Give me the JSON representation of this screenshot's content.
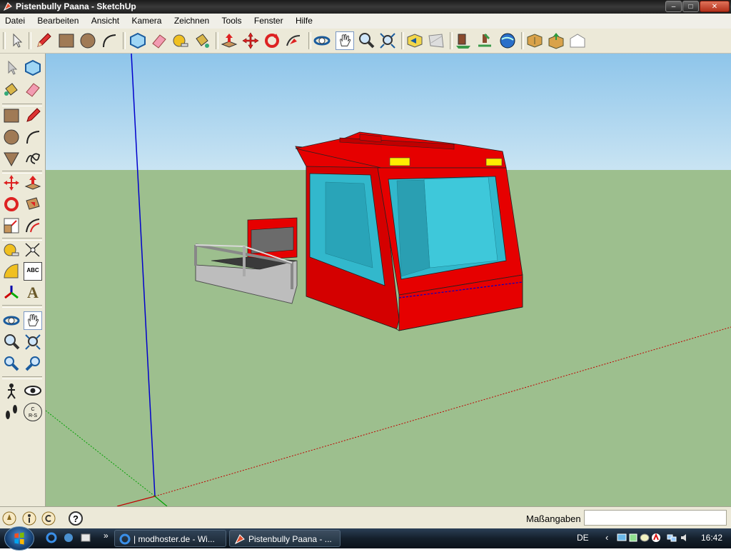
{
  "window": {
    "title": "Pistenbully Paana - SketchUp",
    "controls": {
      "minimize": "–",
      "maximize": "□",
      "close": "✕"
    }
  },
  "menu": [
    "Datei",
    "Bearbeiten",
    "Ansicht",
    "Kamera",
    "Zeichnen",
    "Tools",
    "Fenster",
    "Hilfe"
  ],
  "toolbar_icons": [
    "select-icon",
    "pencil-icon",
    "rectangle-icon",
    "circle-icon",
    "arc-icon",
    "make-component-icon",
    "eraser-icon",
    "tape-measure-icon",
    "paint-bucket-icon",
    "push-pull-icon",
    "move-icon",
    "rotate-icon",
    "follow-me-icon",
    "orbit-icon",
    "pan-icon",
    "zoom-icon",
    "zoom-extents-icon",
    "previous-view-icon",
    "next-view-icon",
    "get-models-icon",
    "share-model-icon",
    "google-earth-icon",
    "make-component-2-icon",
    "share-component-icon",
    "get-current-view-icon"
  ],
  "left_tools": [
    "select-icon",
    "make-component-icon",
    "paint-bucket-icon",
    "eraser-icon",
    "rectangle-icon",
    "pencil-icon",
    "circle-icon",
    "arc-icon",
    "polygon-icon",
    "freehand-icon",
    "move-icon",
    "push-pull-icon",
    "rotate-icon",
    "follow-me-icon",
    "scale-icon",
    "offset-icon",
    "tape-measure-icon",
    "dimension-icon",
    "protractor-icon",
    "text-icon",
    "axes-icon",
    "3d-text-icon",
    "orbit-icon",
    "pan-icon",
    "zoom-icon",
    "zoom-window-icon",
    "previous-icon",
    "zoom-extents-icon",
    "position-camera-icon",
    "look-around-icon",
    "walk-icon",
    "section-plane-icon"
  ],
  "left_tool_labels": {
    "dimension": "ABC",
    "text": "A",
    "section": "C\nR-S"
  },
  "status": {
    "help_icon": "?",
    "measurements_label": "Maßangaben",
    "measurements_value": ""
  },
  "taskbar": {
    "tasks": [
      {
        "label": "| modhoster.de - Wi...",
        "icon": "ie-icon",
        "active": false
      },
      {
        "label": "Pistenbully Paana - ...",
        "icon": "sketchup-icon",
        "active": true
      }
    ],
    "quicklaunch_more": "»",
    "language": "DE",
    "tray_chevron": "‹",
    "clock": "16:42"
  },
  "colors": {
    "sky": "#a7cfe8",
    "ground": "#9dbf8e",
    "model_red": "#e60000",
    "glass": "#32b8cc",
    "axis_blue": "#0000cc",
    "axis_red": "#c00000",
    "axis_green": "#00a000"
  }
}
